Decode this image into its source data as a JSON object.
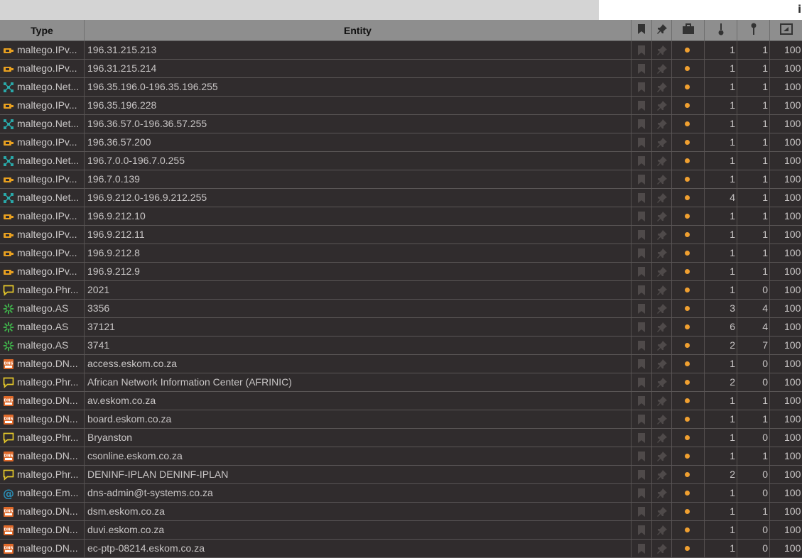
{
  "header": {
    "type_label": "Type",
    "entity_label": "Entity"
  },
  "colors": {
    "ip_icon": "#e8a020",
    "netblock_icon": "#2aa8a8",
    "phrase_icon": "#e3c62a",
    "as_icon": "#3fae4a",
    "dns_icon": "#e06a2a",
    "email_icon": "#2a8fb8",
    "status_dot": "#f0a030"
  },
  "rows": [
    {
      "icon": "ip-icon",
      "type": "maltego.IPv...",
      "entity": "196.31.215.213",
      "incoming": "1",
      "outgoing": "1",
      "weight": "100"
    },
    {
      "icon": "ip-icon",
      "type": "maltego.IPv...",
      "entity": "196.31.215.214",
      "incoming": "1",
      "outgoing": "1",
      "weight": "100"
    },
    {
      "icon": "netblock-icon",
      "type": "maltego.Net...",
      "entity": "196.35.196.0-196.35.196.255",
      "incoming": "1",
      "outgoing": "1",
      "weight": "100"
    },
    {
      "icon": "ip-icon",
      "type": "maltego.IPv...",
      "entity": "196.35.196.228",
      "incoming": "1",
      "outgoing": "1",
      "weight": "100"
    },
    {
      "icon": "netblock-icon",
      "type": "maltego.Net...",
      "entity": "196.36.57.0-196.36.57.255",
      "incoming": "1",
      "outgoing": "1",
      "weight": "100"
    },
    {
      "icon": "ip-icon",
      "type": "maltego.IPv...",
      "entity": "196.36.57.200",
      "incoming": "1",
      "outgoing": "1",
      "weight": "100"
    },
    {
      "icon": "netblock-icon",
      "type": "maltego.Net...",
      "entity": "196.7.0.0-196.7.0.255",
      "incoming": "1",
      "outgoing": "1",
      "weight": "100"
    },
    {
      "icon": "ip-icon",
      "type": "maltego.IPv...",
      "entity": "196.7.0.139",
      "incoming": "1",
      "outgoing": "1",
      "weight": "100"
    },
    {
      "icon": "netblock-icon",
      "type": "maltego.Net...",
      "entity": "196.9.212.0-196.9.212.255",
      "incoming": "4",
      "outgoing": "1",
      "weight": "100"
    },
    {
      "icon": "ip-icon",
      "type": "maltego.IPv...",
      "entity": "196.9.212.10",
      "incoming": "1",
      "outgoing": "1",
      "weight": "100"
    },
    {
      "icon": "ip-icon",
      "type": "maltego.IPv...",
      "entity": "196.9.212.11",
      "incoming": "1",
      "outgoing": "1",
      "weight": "100"
    },
    {
      "icon": "ip-icon",
      "type": "maltego.IPv...",
      "entity": "196.9.212.8",
      "incoming": "1",
      "outgoing": "1",
      "weight": "100"
    },
    {
      "icon": "ip-icon",
      "type": "maltego.IPv...",
      "entity": "196.9.212.9",
      "incoming": "1",
      "outgoing": "1",
      "weight": "100"
    },
    {
      "icon": "phrase-icon",
      "type": "maltego.Phr...",
      "entity": "2021",
      "incoming": "1",
      "outgoing": "0",
      "weight": "100"
    },
    {
      "icon": "as-icon",
      "type": "maltego.AS",
      "entity": "3356",
      "incoming": "3",
      "outgoing": "4",
      "weight": "100"
    },
    {
      "icon": "as-icon",
      "type": "maltego.AS",
      "entity": "37121",
      "incoming": "6",
      "outgoing": "4",
      "weight": "100"
    },
    {
      "icon": "as-icon",
      "type": "maltego.AS",
      "entity": "3741",
      "incoming": "2",
      "outgoing": "7",
      "weight": "100"
    },
    {
      "icon": "dns-icon",
      "type": "maltego.DN...",
      "entity": "access.eskom.co.za",
      "incoming": "1",
      "outgoing": "0",
      "weight": "100"
    },
    {
      "icon": "phrase-icon",
      "type": "maltego.Phr...",
      "entity": "African Network Information Center (AFRINIC)",
      "incoming": "2",
      "outgoing": "0",
      "weight": "100"
    },
    {
      "icon": "dns-icon",
      "type": "maltego.DN...",
      "entity": "av.eskom.co.za",
      "incoming": "1",
      "outgoing": "1",
      "weight": "100"
    },
    {
      "icon": "dns-icon",
      "type": "maltego.DN...",
      "entity": "board.eskom.co.za",
      "incoming": "1",
      "outgoing": "1",
      "weight": "100"
    },
    {
      "icon": "phrase-icon",
      "type": "maltego.Phr...",
      "entity": "Bryanston",
      "incoming": "1",
      "outgoing": "0",
      "weight": "100"
    },
    {
      "icon": "dns-icon",
      "type": "maltego.DN...",
      "entity": "csonline.eskom.co.za",
      "incoming": "1",
      "outgoing": "1",
      "weight": "100"
    },
    {
      "icon": "phrase-icon",
      "type": "maltego.Phr...",
      "entity": "DENINF-IPLAN DENINF-IPLAN",
      "incoming": "2",
      "outgoing": "0",
      "weight": "100"
    },
    {
      "icon": "email-icon",
      "type": "maltego.Em...",
      "entity": "dns-admin@t-systems.co.za",
      "incoming": "1",
      "outgoing": "0",
      "weight": "100"
    },
    {
      "icon": "dns-icon",
      "type": "maltego.DN...",
      "entity": "dsm.eskom.co.za",
      "incoming": "1",
      "outgoing": "1",
      "weight": "100"
    },
    {
      "icon": "dns-icon",
      "type": "maltego.DN...",
      "entity": "duvi.eskom.co.za",
      "incoming": "1",
      "outgoing": "0",
      "weight": "100"
    },
    {
      "icon": "dns-icon",
      "type": "maltego.DN...",
      "entity": "ec-ptp-08214.eskom.co.za",
      "incoming": "1",
      "outgoing": "0",
      "weight": "100"
    }
  ]
}
